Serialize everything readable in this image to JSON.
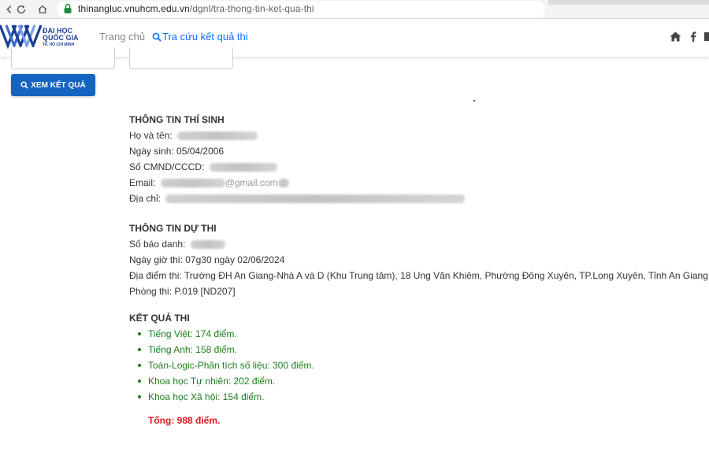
{
  "browser": {
    "url_host": "thinangluc.vnuhcm.edu.vn",
    "url_path": "/dgnl/tra-thong-tin-ket-qua-thi"
  },
  "header": {
    "logo": {
      "line1": "ĐẠI HỌC",
      "line2": "QUỐC GIA",
      "line3": "TP. HỒ CHÍ MINH"
    },
    "nav": {
      "home": "Trang chủ",
      "search": "Tra cứu kết quả thi"
    },
    "icons": [
      "home-icon",
      "facebook-icon",
      "youtube-icon"
    ]
  },
  "form": {
    "submit_label": "XEM KẾT QUẢ"
  },
  "candidate": {
    "heading": "THÔNG TIN THÍ SINH",
    "name_label": "Họ và tên:",
    "dob_label": "Ngày sinh:",
    "dob": "05/04/2006",
    "id_label": "Số CMND/CCCD:",
    "email_label": "Email:",
    "email_partial": "@gmail.com",
    "address_label": "Địa chỉ:"
  },
  "exam": {
    "heading": "THÔNG TIN DỰ THI",
    "sbd_label": "Số báo danh:",
    "datetime_label": "Ngày giờ thi:",
    "datetime": "07g30 ngày 02/06/2024",
    "location_label": "Địa điểm thi:",
    "location": "Trường ĐH An Giang-Nhà A và D (Khu Trung tâm), 18 Ung Văn Khiêm, Phường Đông Xuyên, TP.Long Xuyên, Tỉnh An Giang",
    "room_label": "Phòng thi:",
    "room": "P.019 [ND207]"
  },
  "results": {
    "heading": "KẾT QUẢ THI",
    "items": [
      "Tiếng Việt: 174 điểm.",
      "Tiếng Anh: 158 điểm.",
      "Toán-Logic-Phân tích số liệu: 300 điểm.",
      "Khoa học Tự nhiên: 202 điểm.",
      "Khoa học Xã hội: 154 điểm."
    ],
    "total": "Tổng: 988 điểm."
  },
  "colors": {
    "primary": "#1565c0",
    "link": "#0d6efd",
    "score_green": "#1e7e1e",
    "total_red": "#e01b1b",
    "logo_navy": "#1c3f94"
  }
}
